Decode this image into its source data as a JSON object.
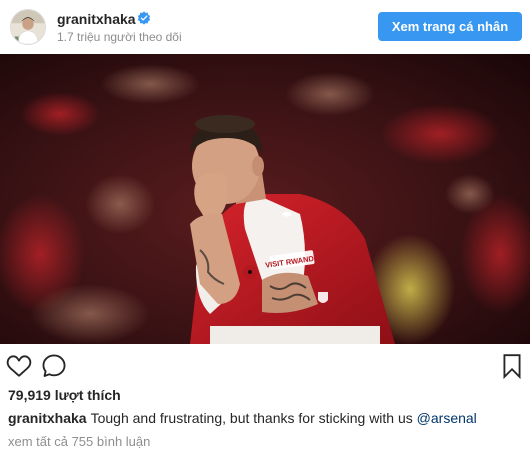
{
  "header": {
    "username": "granitxhaka",
    "followers": "1.7 triệu người theo dõi",
    "profile_button": "Xem trang cá nhân"
  },
  "actions": {
    "like_icon": "heart-outline-icon",
    "comment_icon": "comment-bubble-icon",
    "bookmark_icon": "bookmark-outline-icon"
  },
  "likes": "79,919 lượt thích",
  "caption": {
    "username": "granitxhaka",
    "text": "Tough and frustrating, but thanks for sticking with us ",
    "mention": "@arsenal"
  },
  "comments_link": "xem tất cả 755 bình luận",
  "photo": {
    "jersey_sponsor": "VISIT RWANDA"
  },
  "colors": {
    "accent": "#3897f0",
    "verified": "#3897f0",
    "mention": "#003569",
    "muted": "#8e8e8e"
  }
}
